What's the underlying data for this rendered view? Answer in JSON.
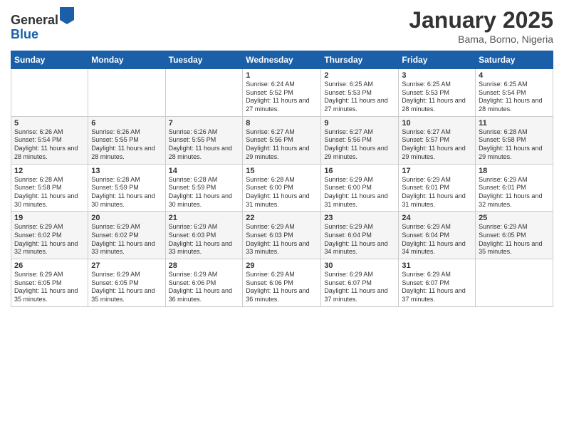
{
  "header": {
    "logo_general": "General",
    "logo_blue": "Blue",
    "title": "January 2025",
    "subtitle": "Bama, Borno, Nigeria"
  },
  "weekdays": [
    "Sunday",
    "Monday",
    "Tuesday",
    "Wednesday",
    "Thursday",
    "Friday",
    "Saturday"
  ],
  "weeks": [
    [
      {
        "day": "",
        "info": ""
      },
      {
        "day": "",
        "info": ""
      },
      {
        "day": "",
        "info": ""
      },
      {
        "day": "1",
        "info": "Sunrise: 6:24 AM\nSunset: 5:52 PM\nDaylight: 11 hours and 27 minutes."
      },
      {
        "day": "2",
        "info": "Sunrise: 6:25 AM\nSunset: 5:53 PM\nDaylight: 11 hours and 27 minutes."
      },
      {
        "day": "3",
        "info": "Sunrise: 6:25 AM\nSunset: 5:53 PM\nDaylight: 11 hours and 28 minutes."
      },
      {
        "day": "4",
        "info": "Sunrise: 6:25 AM\nSunset: 5:54 PM\nDaylight: 11 hours and 28 minutes."
      }
    ],
    [
      {
        "day": "5",
        "info": "Sunrise: 6:26 AM\nSunset: 5:54 PM\nDaylight: 11 hours and 28 minutes."
      },
      {
        "day": "6",
        "info": "Sunrise: 6:26 AM\nSunset: 5:55 PM\nDaylight: 11 hours and 28 minutes."
      },
      {
        "day": "7",
        "info": "Sunrise: 6:26 AM\nSunset: 5:55 PM\nDaylight: 11 hours and 28 minutes."
      },
      {
        "day": "8",
        "info": "Sunrise: 6:27 AM\nSunset: 5:56 PM\nDaylight: 11 hours and 29 minutes."
      },
      {
        "day": "9",
        "info": "Sunrise: 6:27 AM\nSunset: 5:56 PM\nDaylight: 11 hours and 29 minutes."
      },
      {
        "day": "10",
        "info": "Sunrise: 6:27 AM\nSunset: 5:57 PM\nDaylight: 11 hours and 29 minutes."
      },
      {
        "day": "11",
        "info": "Sunrise: 6:28 AM\nSunset: 5:58 PM\nDaylight: 11 hours and 29 minutes."
      }
    ],
    [
      {
        "day": "12",
        "info": "Sunrise: 6:28 AM\nSunset: 5:58 PM\nDaylight: 11 hours and 30 minutes."
      },
      {
        "day": "13",
        "info": "Sunrise: 6:28 AM\nSunset: 5:59 PM\nDaylight: 11 hours and 30 minutes."
      },
      {
        "day": "14",
        "info": "Sunrise: 6:28 AM\nSunset: 5:59 PM\nDaylight: 11 hours and 30 minutes."
      },
      {
        "day": "15",
        "info": "Sunrise: 6:28 AM\nSunset: 6:00 PM\nDaylight: 11 hours and 31 minutes."
      },
      {
        "day": "16",
        "info": "Sunrise: 6:29 AM\nSunset: 6:00 PM\nDaylight: 11 hours and 31 minutes."
      },
      {
        "day": "17",
        "info": "Sunrise: 6:29 AM\nSunset: 6:01 PM\nDaylight: 11 hours and 31 minutes."
      },
      {
        "day": "18",
        "info": "Sunrise: 6:29 AM\nSunset: 6:01 PM\nDaylight: 11 hours and 32 minutes."
      }
    ],
    [
      {
        "day": "19",
        "info": "Sunrise: 6:29 AM\nSunset: 6:02 PM\nDaylight: 11 hours and 32 minutes."
      },
      {
        "day": "20",
        "info": "Sunrise: 6:29 AM\nSunset: 6:02 PM\nDaylight: 11 hours and 33 minutes."
      },
      {
        "day": "21",
        "info": "Sunrise: 6:29 AM\nSunset: 6:03 PM\nDaylight: 11 hours and 33 minutes."
      },
      {
        "day": "22",
        "info": "Sunrise: 6:29 AM\nSunset: 6:03 PM\nDaylight: 11 hours and 33 minutes."
      },
      {
        "day": "23",
        "info": "Sunrise: 6:29 AM\nSunset: 6:04 PM\nDaylight: 11 hours and 34 minutes."
      },
      {
        "day": "24",
        "info": "Sunrise: 6:29 AM\nSunset: 6:04 PM\nDaylight: 11 hours and 34 minutes."
      },
      {
        "day": "25",
        "info": "Sunrise: 6:29 AM\nSunset: 6:05 PM\nDaylight: 11 hours and 35 minutes."
      }
    ],
    [
      {
        "day": "26",
        "info": "Sunrise: 6:29 AM\nSunset: 6:05 PM\nDaylight: 11 hours and 35 minutes."
      },
      {
        "day": "27",
        "info": "Sunrise: 6:29 AM\nSunset: 6:05 PM\nDaylight: 11 hours and 35 minutes."
      },
      {
        "day": "28",
        "info": "Sunrise: 6:29 AM\nSunset: 6:06 PM\nDaylight: 11 hours and 36 minutes."
      },
      {
        "day": "29",
        "info": "Sunrise: 6:29 AM\nSunset: 6:06 PM\nDaylight: 11 hours and 36 minutes."
      },
      {
        "day": "30",
        "info": "Sunrise: 6:29 AM\nSunset: 6:07 PM\nDaylight: 11 hours and 37 minutes."
      },
      {
        "day": "31",
        "info": "Sunrise: 6:29 AM\nSunset: 6:07 PM\nDaylight: 11 hours and 37 minutes."
      },
      {
        "day": "",
        "info": ""
      }
    ]
  ]
}
